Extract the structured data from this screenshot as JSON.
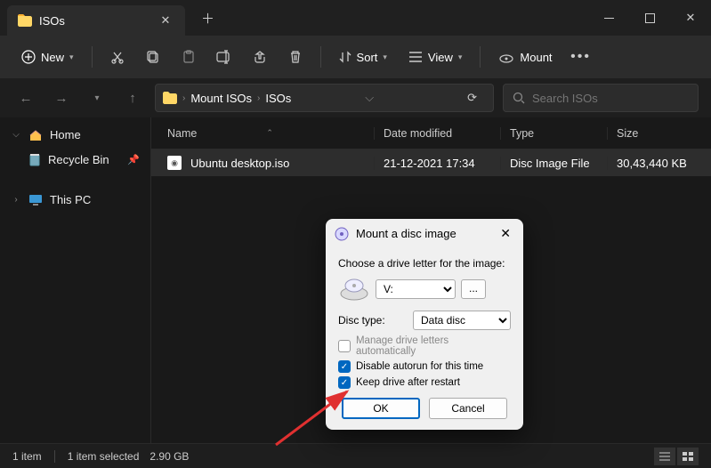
{
  "window": {
    "tab_title": "ISOs",
    "new_btn": "New"
  },
  "toolbar": {
    "sort": "Sort",
    "view": "View",
    "mount": "Mount"
  },
  "breadcrumb": {
    "items": [
      "Mount ISOs",
      "ISOs"
    ]
  },
  "search": {
    "placeholder": "Search ISOs",
    "value": ""
  },
  "sidebar": {
    "home": "Home",
    "recycle": "Recycle Bin",
    "thispc": "This PC"
  },
  "columns": {
    "name": "Name",
    "date": "Date modified",
    "type": "Type",
    "size": "Size"
  },
  "rows": [
    {
      "name": "Ubuntu desktop.iso",
      "date": "21-12-2021 17:34",
      "type": "Disc Image File",
      "size": "30,43,440 KB"
    }
  ],
  "status": {
    "count": "1 item",
    "selected": "1 item selected",
    "size": "2.90 GB"
  },
  "dialog": {
    "title": "Mount a disc image",
    "prompt": "Choose a drive letter for the image:",
    "drive": "V:",
    "disc_type_label": "Disc type:",
    "disc_type": "Data disc",
    "opt_manage": "Manage drive letters automatically",
    "opt_disable_autorun": "Disable autorun for this time",
    "opt_keep": "Keep drive after restart",
    "ok": "OK",
    "cancel": "Cancel"
  }
}
